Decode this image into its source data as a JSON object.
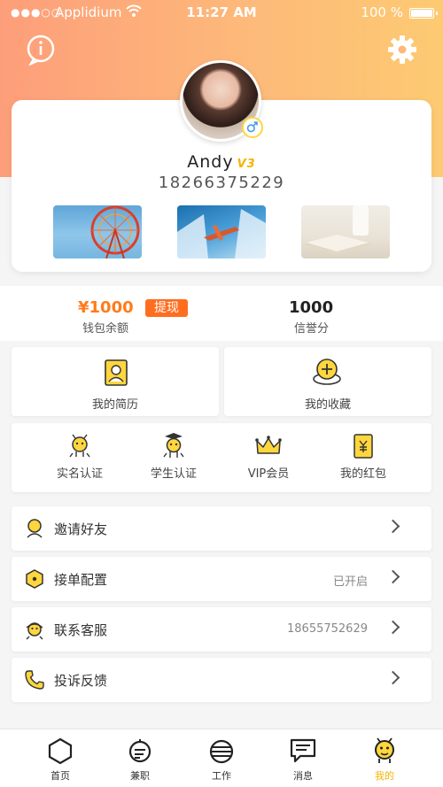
{
  "status_bar": {
    "signal": "●●●○○",
    "carrier": "Applidium",
    "time": "11:27 AM",
    "battery": "100 %"
  },
  "header": {
    "info_icon": "info-icon",
    "settings_icon": "gear-icon"
  },
  "profile": {
    "name": "Andy",
    "vip_badge": "V3",
    "phone": "18266375229",
    "gender_icon": "female-icon",
    "photos": [
      {
        "name": "ferris-wheel-photo"
      },
      {
        "name": "airplane-photo"
      },
      {
        "name": "book-photo"
      }
    ]
  },
  "wallet": {
    "amount": "¥1000",
    "withdraw": "提现",
    "balance_label": "钱包余额",
    "credit": "1000",
    "credit_label": "信誉分"
  },
  "quick": [
    {
      "label": "我的简历",
      "icon": "resume-icon"
    },
    {
      "label": "我的收藏",
      "icon": "favorites-icon"
    }
  ],
  "certs": [
    {
      "label": "实名认证",
      "icon": "bee-id-icon"
    },
    {
      "label": "学生认证",
      "icon": "bee-student-icon"
    },
    {
      "label": "VIP会员",
      "icon": "crown-icon"
    },
    {
      "label": "我的红包",
      "icon": "red-envelope-icon"
    }
  ],
  "menu": [
    {
      "label": "邀请好友",
      "value": "",
      "icon": "invite-icon"
    },
    {
      "label": "接单配置",
      "value": "已开启",
      "icon": "hexagon-icon"
    },
    {
      "label": "联系客服",
      "value": "18655752629",
      "icon": "service-icon"
    },
    {
      "label": "投诉反馈",
      "value": "",
      "icon": "phone-icon"
    }
  ],
  "tabs": [
    {
      "label": "首页"
    },
    {
      "label": "兼职"
    },
    {
      "label": "工作"
    },
    {
      "label": "消息"
    },
    {
      "label": "我的"
    }
  ],
  "colors": {
    "accent": "#f5b400",
    "orange": "#ff6d1f",
    "gradient_start": "#fd9e7a",
    "gradient_end": "#fdca72"
  }
}
